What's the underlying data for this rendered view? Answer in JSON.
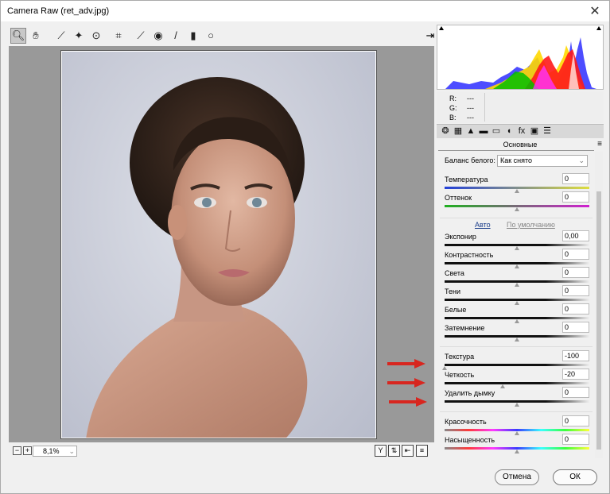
{
  "window": {
    "title": "Camera Raw (ret_adv.jpg)",
    "close_glyph": "✕"
  },
  "toolbar": {
    "tools": [
      {
        "name": "zoom-tool-icon",
        "glyph": "🔍︎",
        "active": true
      },
      {
        "name": "hand-tool-icon",
        "glyph": "✋︎",
        "active": false
      },
      {
        "name": "white-balance-tool-icon",
        "glyph": "⟋",
        "active": false
      },
      {
        "name": "color-sampler-tool-icon",
        "glyph": "✦",
        "active": false
      },
      {
        "name": "targeted-adjustment-tool-icon",
        "glyph": "⊙",
        "active": false
      },
      {
        "name": "crop-tool-icon",
        "glyph": "⌗",
        "active": false
      },
      {
        "name": "spot-removal-tool-icon",
        "glyph": "⟋",
        "active": false
      },
      {
        "name": "red-eye-tool-icon",
        "glyph": "◉",
        "active": false
      },
      {
        "name": "adjustment-brush-icon",
        "glyph": "/",
        "active": false
      },
      {
        "name": "graduated-filter-icon",
        "glyph": "▮",
        "active": false
      },
      {
        "name": "radial-filter-icon",
        "glyph": "○",
        "active": false
      }
    ],
    "open_preferences_glyph": "⇥"
  },
  "bottom": {
    "zoom_out": "−",
    "zoom_in": "+",
    "zoom_value": "8,1%",
    "icons": [
      {
        "name": "before-after-y-icon",
        "glyph": "Y"
      },
      {
        "name": "swap-before-after-icon",
        "glyph": "⇅"
      },
      {
        "name": "copy-settings-icon",
        "glyph": "⇤"
      },
      {
        "name": "toggle-settings-icon",
        "glyph": "≡"
      }
    ]
  },
  "rgb": {
    "r_label": "R:",
    "g_label": "G:",
    "b_label": "B:",
    "r": "---",
    "g": "---",
    "b": "---"
  },
  "panel": {
    "tabs": [
      "❂",
      "▦",
      "▲",
      "▬",
      "▭",
      "◖",
      "fx",
      "▣",
      "☰"
    ],
    "title": "Основные",
    "menu_glyph": "≡",
    "wb_label": "Баланс белого:",
    "wb_value": "Как снято",
    "auto_label": "Авто",
    "default_label": "По умолчанию",
    "sliders": [
      {
        "label": "Температура",
        "value": "0",
        "pos": 0.5,
        "track": "temp"
      },
      {
        "label": "Оттенок",
        "value": "0",
        "pos": 0.5,
        "track": "tint"
      },
      {
        "label": "Экспонир",
        "value": "0,00",
        "pos": 0.5,
        "track": "dark"
      },
      {
        "label": "Контрастность",
        "value": "0",
        "pos": 0.5,
        "track": "dark"
      },
      {
        "label": "Света",
        "value": "0",
        "pos": 0.5,
        "track": "dark"
      },
      {
        "label": "Тени",
        "value": "0",
        "pos": 0.5,
        "track": "dark"
      },
      {
        "label": "Белые",
        "value": "0",
        "pos": 0.5,
        "track": "dark"
      },
      {
        "label": "Затемнение",
        "value": "0",
        "pos": 0.5,
        "track": "dark"
      },
      {
        "label": "Текстура",
        "value": "-100",
        "pos": 0.0,
        "track": "dark"
      },
      {
        "label": "Четкость",
        "value": "-20",
        "pos": 0.4,
        "track": "dark"
      },
      {
        "label": "Удалить дымку",
        "value": "0",
        "pos": 0.5,
        "track": "dark"
      },
      {
        "label": "Красочность",
        "value": "0",
        "pos": 0.5,
        "track": "color"
      },
      {
        "label": "Насыщенность",
        "value": "0",
        "pos": 0.5,
        "track": "color"
      }
    ]
  },
  "buttons": {
    "cancel": "Отмена",
    "ok": "ОК"
  },
  "colors": {
    "arrow": "#d8261f",
    "accent": "#1a3d8a"
  }
}
